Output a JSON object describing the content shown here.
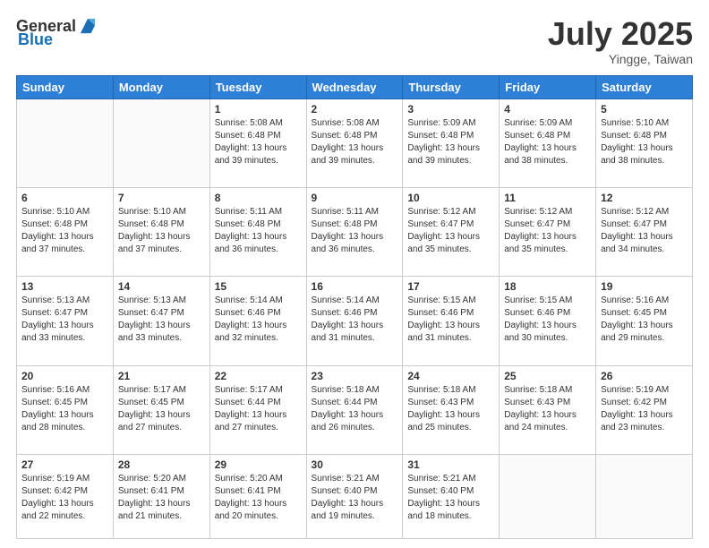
{
  "header": {
    "logo_general": "General",
    "logo_blue": "Blue",
    "month_year": "July 2025",
    "location": "Yingge, Taiwan"
  },
  "weekdays": [
    "Sunday",
    "Monday",
    "Tuesday",
    "Wednesday",
    "Thursday",
    "Friday",
    "Saturday"
  ],
  "weeks": [
    [
      {
        "day": "",
        "info": ""
      },
      {
        "day": "",
        "info": ""
      },
      {
        "day": "1",
        "info": "Sunrise: 5:08 AM\nSunset: 6:48 PM\nDaylight: 13 hours and 39 minutes."
      },
      {
        "day": "2",
        "info": "Sunrise: 5:08 AM\nSunset: 6:48 PM\nDaylight: 13 hours and 39 minutes."
      },
      {
        "day": "3",
        "info": "Sunrise: 5:09 AM\nSunset: 6:48 PM\nDaylight: 13 hours and 39 minutes."
      },
      {
        "day": "4",
        "info": "Sunrise: 5:09 AM\nSunset: 6:48 PM\nDaylight: 13 hours and 38 minutes."
      },
      {
        "day": "5",
        "info": "Sunrise: 5:10 AM\nSunset: 6:48 PM\nDaylight: 13 hours and 38 minutes."
      }
    ],
    [
      {
        "day": "6",
        "info": "Sunrise: 5:10 AM\nSunset: 6:48 PM\nDaylight: 13 hours and 37 minutes."
      },
      {
        "day": "7",
        "info": "Sunrise: 5:10 AM\nSunset: 6:48 PM\nDaylight: 13 hours and 37 minutes."
      },
      {
        "day": "8",
        "info": "Sunrise: 5:11 AM\nSunset: 6:48 PM\nDaylight: 13 hours and 36 minutes."
      },
      {
        "day": "9",
        "info": "Sunrise: 5:11 AM\nSunset: 6:48 PM\nDaylight: 13 hours and 36 minutes."
      },
      {
        "day": "10",
        "info": "Sunrise: 5:12 AM\nSunset: 6:47 PM\nDaylight: 13 hours and 35 minutes."
      },
      {
        "day": "11",
        "info": "Sunrise: 5:12 AM\nSunset: 6:47 PM\nDaylight: 13 hours and 35 minutes."
      },
      {
        "day": "12",
        "info": "Sunrise: 5:12 AM\nSunset: 6:47 PM\nDaylight: 13 hours and 34 minutes."
      }
    ],
    [
      {
        "day": "13",
        "info": "Sunrise: 5:13 AM\nSunset: 6:47 PM\nDaylight: 13 hours and 33 minutes."
      },
      {
        "day": "14",
        "info": "Sunrise: 5:13 AM\nSunset: 6:47 PM\nDaylight: 13 hours and 33 minutes."
      },
      {
        "day": "15",
        "info": "Sunrise: 5:14 AM\nSunset: 6:46 PM\nDaylight: 13 hours and 32 minutes."
      },
      {
        "day": "16",
        "info": "Sunrise: 5:14 AM\nSunset: 6:46 PM\nDaylight: 13 hours and 31 minutes."
      },
      {
        "day": "17",
        "info": "Sunrise: 5:15 AM\nSunset: 6:46 PM\nDaylight: 13 hours and 31 minutes."
      },
      {
        "day": "18",
        "info": "Sunrise: 5:15 AM\nSunset: 6:46 PM\nDaylight: 13 hours and 30 minutes."
      },
      {
        "day": "19",
        "info": "Sunrise: 5:16 AM\nSunset: 6:45 PM\nDaylight: 13 hours and 29 minutes."
      }
    ],
    [
      {
        "day": "20",
        "info": "Sunrise: 5:16 AM\nSunset: 6:45 PM\nDaylight: 13 hours and 28 minutes."
      },
      {
        "day": "21",
        "info": "Sunrise: 5:17 AM\nSunset: 6:45 PM\nDaylight: 13 hours and 27 minutes."
      },
      {
        "day": "22",
        "info": "Sunrise: 5:17 AM\nSunset: 6:44 PM\nDaylight: 13 hours and 27 minutes."
      },
      {
        "day": "23",
        "info": "Sunrise: 5:18 AM\nSunset: 6:44 PM\nDaylight: 13 hours and 26 minutes."
      },
      {
        "day": "24",
        "info": "Sunrise: 5:18 AM\nSunset: 6:43 PM\nDaylight: 13 hours and 25 minutes."
      },
      {
        "day": "25",
        "info": "Sunrise: 5:18 AM\nSunset: 6:43 PM\nDaylight: 13 hours and 24 minutes."
      },
      {
        "day": "26",
        "info": "Sunrise: 5:19 AM\nSunset: 6:42 PM\nDaylight: 13 hours and 23 minutes."
      }
    ],
    [
      {
        "day": "27",
        "info": "Sunrise: 5:19 AM\nSunset: 6:42 PM\nDaylight: 13 hours and 22 minutes."
      },
      {
        "day": "28",
        "info": "Sunrise: 5:20 AM\nSunset: 6:41 PM\nDaylight: 13 hours and 21 minutes."
      },
      {
        "day": "29",
        "info": "Sunrise: 5:20 AM\nSunset: 6:41 PM\nDaylight: 13 hours and 20 minutes."
      },
      {
        "day": "30",
        "info": "Sunrise: 5:21 AM\nSunset: 6:40 PM\nDaylight: 13 hours and 19 minutes."
      },
      {
        "day": "31",
        "info": "Sunrise: 5:21 AM\nSunset: 6:40 PM\nDaylight: 13 hours and 18 minutes."
      },
      {
        "day": "",
        "info": ""
      },
      {
        "day": "",
        "info": ""
      }
    ]
  ]
}
